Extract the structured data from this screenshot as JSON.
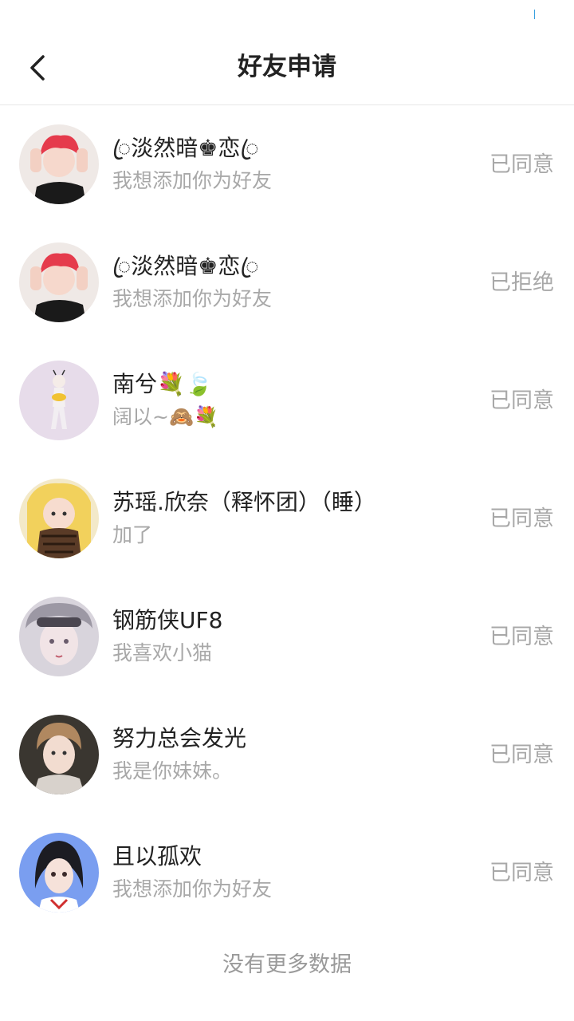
{
  "header": {
    "title": "好友申请",
    "back_icon": "chevron-left-icon"
  },
  "requests": [
    {
      "name": "ꦿ淡然暗♚恋ꦿ",
      "message": "我想添加你为好友",
      "status": "已同意"
    },
    {
      "name": "ꦿ淡然暗♚恋ꦿ",
      "message": "我想添加你为好友",
      "status": "已拒绝"
    },
    {
      "name": "南兮💐🍃",
      "message": "阔以~🙈💐",
      "status": "已同意"
    },
    {
      "name": "苏瑶.欣奈（释怀团）（睡）",
      "message": "加了",
      "status": "已同意"
    },
    {
      "name": "钢筋侠UF8",
      "message": "我喜欢小猫",
      "status": "已同意"
    },
    {
      "name": "努力总会发光",
      "message": "我是你妹妹。",
      "status": "已同意"
    },
    {
      "name": "且以孤欢",
      "message": "我想添加你为好友",
      "status": "已同意"
    }
  ],
  "footer": {
    "text": "没有更多数据"
  },
  "colors": {
    "status_text": "#a8a8a8",
    "title_text": "#222222",
    "divider": "#e6e6e6"
  }
}
